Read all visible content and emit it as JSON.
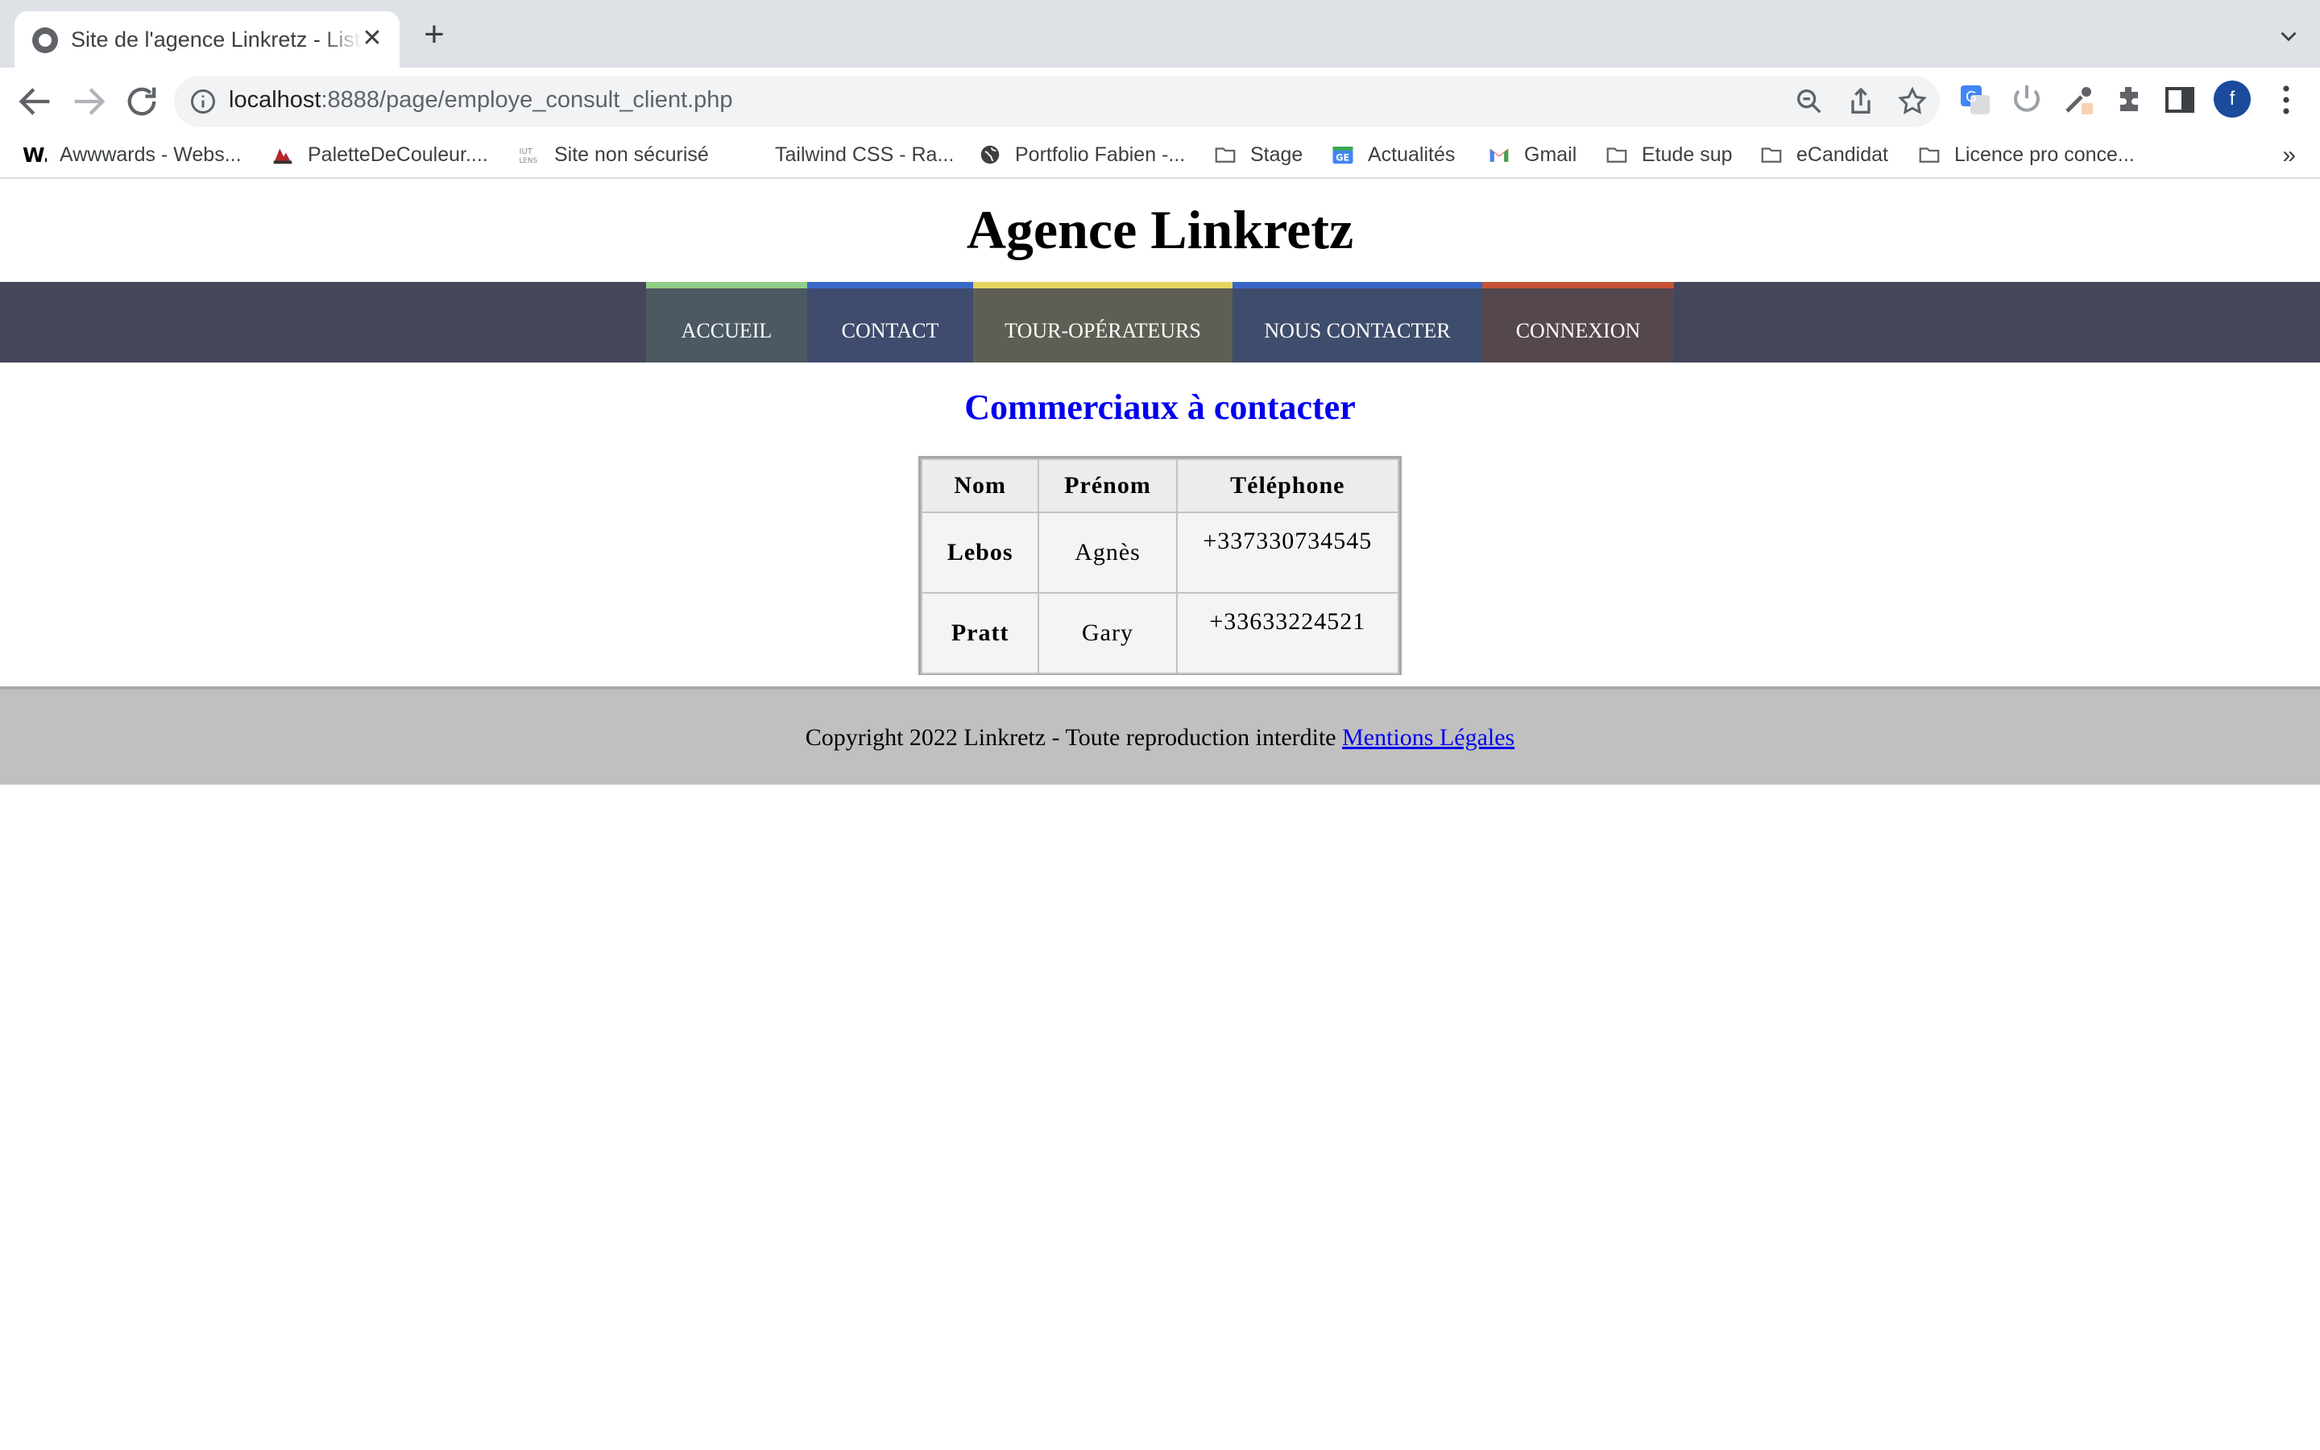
{
  "browser": {
    "tab_title": "Site de l'agence Linkretz - Liste",
    "tab_close": "✕",
    "new_tab": "+",
    "url_host": "localhost",
    "url_rest": ":8888/page/employe_consult_client.php",
    "profile_initial": "f",
    "bookmarks": [
      {
        "label": "Awwwards - Webs...",
        "icon": "awwwards-icon"
      },
      {
        "label": "PaletteDeCouleur....",
        "icon": "palette-icon"
      },
      {
        "label": "Site non sécurisé",
        "icon": "iut-lens-icon"
      },
      {
        "label": "Tailwind CSS - Ra...",
        "icon": "tailwind-icon"
      },
      {
        "label": "Portfolio Fabien -...",
        "icon": "globe-icon"
      },
      {
        "label": "Stage",
        "icon": "folder-icon"
      },
      {
        "label": "Actualités",
        "icon": "google-news-icon"
      },
      {
        "label": "Gmail",
        "icon": "gmail-icon"
      },
      {
        "label": "Etude sup",
        "icon": "folder-icon"
      },
      {
        "label": "eCandidat",
        "icon": "folder-icon"
      },
      {
        "label": "Licence pro conce...",
        "icon": "folder-icon"
      }
    ],
    "bookmarks_more": "»"
  },
  "site": {
    "title": "Agence Linkretz",
    "nav": [
      "ACCUEIL",
      "CONTACT",
      "TOUR-OPÉRATEURS",
      "NOUS CONTACTER",
      "CONNEXION"
    ],
    "nav_colors": {
      "accueil": "#8fce86",
      "contact": "#3b67c7",
      "tour": "#e5d45e",
      "nous": "#3966c6",
      "connexion": "#c55335"
    },
    "heading": "Commerciaux à contacter",
    "table": {
      "headers": [
        "Nom",
        "Prénom",
        "Téléphone"
      ],
      "rows": [
        [
          "Lebos",
          "Agnès",
          "+337330734545"
        ],
        [
          "Pratt",
          "Gary",
          "+33633224521"
        ]
      ]
    },
    "footer": {
      "text": "Copyright 2022 Linkretz - Toute reproduction interdite ",
      "link": "Mentions Légales"
    }
  }
}
